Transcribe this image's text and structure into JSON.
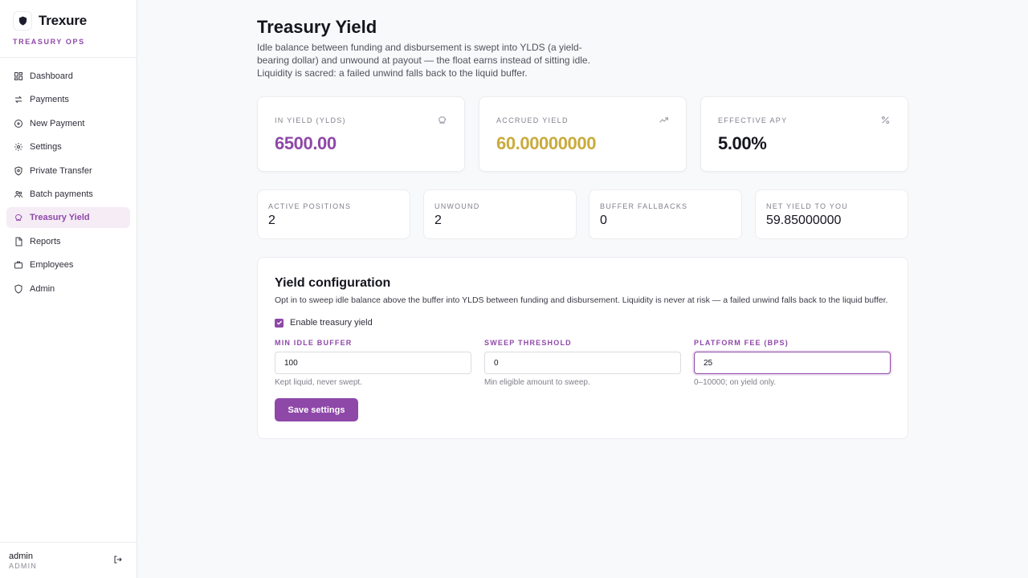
{
  "brand": {
    "name": "Trexure",
    "subtitle": "TREASURY OPS",
    "icon": "shield-icon"
  },
  "sidebar": {
    "items": [
      {
        "label": "Dashboard",
        "icon": "dashboard-icon"
      },
      {
        "label": "Payments",
        "icon": "arrows-swap-icon"
      },
      {
        "label": "New Payment",
        "icon": "plus-circle-icon"
      },
      {
        "label": "Settings",
        "icon": "gear-icon"
      },
      {
        "label": "Private Transfer",
        "icon": "shield-check-icon"
      },
      {
        "label": "Batch payments",
        "icon": "users-icon"
      },
      {
        "label": "Treasury Yield",
        "icon": "piggy-bank-icon",
        "active": true
      },
      {
        "label": "Reports",
        "icon": "file-icon"
      },
      {
        "label": "Employees",
        "icon": "briefcase-icon"
      },
      {
        "label": "Admin",
        "icon": "shield-icon"
      }
    ]
  },
  "user": {
    "name": "admin",
    "role": "ADMIN"
  },
  "page": {
    "title": "Treasury Yield",
    "description": "Idle balance between funding and disbursement is swept into YLDS (a yield-bearing dollar) and unwound at payout — the float earns instead of sitting idle. Liquidity is sacred: a failed unwind falls back to the liquid buffer."
  },
  "stats": [
    {
      "label": "IN YIELD (YLDS)",
      "value": "6500.00",
      "color": "#8e48a8",
      "icon": "piggy-bank-icon"
    },
    {
      "label": "ACCRUED YIELD",
      "value": "60.00000000",
      "color": "#c9ab3c",
      "icon": "trending-up-icon"
    },
    {
      "label": "EFFECTIVE APY",
      "value": "5.00%",
      "color": "#15151f",
      "icon": "percent-icon"
    }
  ],
  "metrics": [
    {
      "label": "ACTIVE POSITIONS",
      "value": "2"
    },
    {
      "label": "UNWOUND",
      "value": "2"
    },
    {
      "label": "BUFFER FALLBACKS",
      "value": "0"
    },
    {
      "label": "NET YIELD TO YOU",
      "value": "59.85000000"
    }
  ],
  "config": {
    "title": "Yield configuration",
    "description": "Opt in to sweep idle balance above the buffer into YLDS between funding and disbursement. Liquidity is never at risk — a failed unwind falls back to the liquid buffer.",
    "enable_label": "Enable treasury yield",
    "enabled": true,
    "fields": [
      {
        "label": "MIN IDLE BUFFER",
        "value": "100",
        "help": "Kept liquid, never swept."
      },
      {
        "label": "SWEEP THRESHOLD",
        "value": "0",
        "help": "Min eligible amount to sweep."
      },
      {
        "label": "PLATFORM FEE (BPS)",
        "value": "25",
        "help": "0–10000; on yield only."
      }
    ],
    "save_label": "Save settings"
  },
  "colors": {
    "accent": "#8e48a8",
    "accent_soft": "#f5ecf6",
    "gold": "#c9ab3c"
  }
}
